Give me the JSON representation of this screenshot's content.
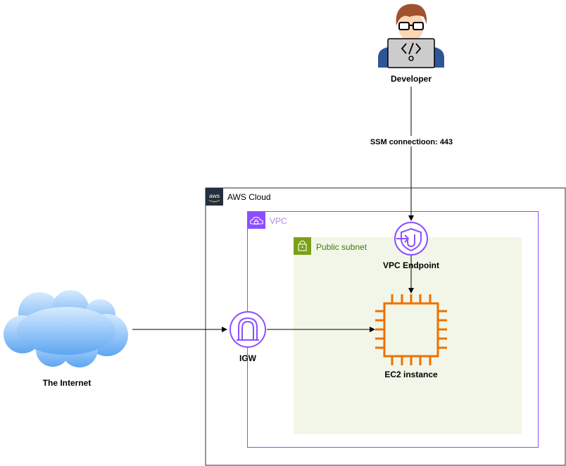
{
  "developer": {
    "label": "Developer"
  },
  "connection": {
    "label": "SSM connectioon: 443"
  },
  "aws_cloud": {
    "label": "AWS Cloud",
    "badge": "aws"
  },
  "vpc": {
    "label": "VPC"
  },
  "subnet": {
    "label": "Public subnet"
  },
  "vpc_endpoint": {
    "label": "VPC Endpoint"
  },
  "igw": {
    "label": "IGW"
  },
  "ec2": {
    "label": "EC2 instance"
  },
  "internet": {
    "label": "The Internet"
  },
  "colors": {
    "aws_cloud_border": "#232f3e",
    "vpc_border": "#8c4fff",
    "subnet_fill": "#f2f6e8",
    "subnet_accent": "#7aa116",
    "ec2_orange": "#ed7100",
    "network_purple": "#8c4fff",
    "cloud_blue": "#73b5f5"
  }
}
